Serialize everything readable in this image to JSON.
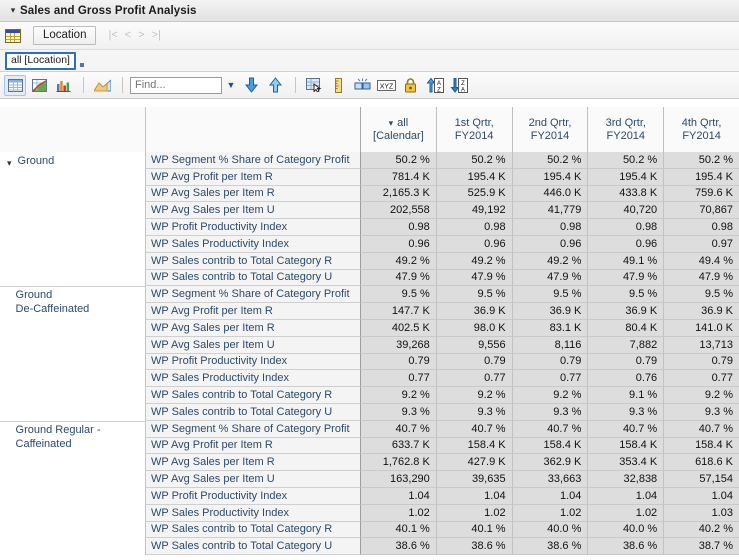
{
  "window": {
    "title": "Sales and Gross Profit Analysis",
    "collapse_icon": "chevron-down-icon"
  },
  "filter_bar": {
    "grid_icon": "grid-icon",
    "dimension_button": "Location",
    "nav_first": "|<",
    "nav_prev": "<",
    "nav_next": ">",
    "nav_last": ">|"
  },
  "token_bar": {
    "token": "all [Location]",
    "marker": "resize-handle-icon"
  },
  "toolbar": {
    "buttons": [
      {
        "name": "table-view-icon",
        "selected": true
      },
      {
        "name": "chart-table-view-icon",
        "selected": false
      },
      {
        "name": "bar-chart-icon",
        "selected": false
      },
      {
        "name": "area-chart-icon",
        "selected": false
      }
    ],
    "find_placeholder": "Find...",
    "find_value": "",
    "find_dropdown_icon": "chevron-down-icon",
    "find_next_icon": "arrow-down-icon",
    "find_prev_icon": "arrow-up-icon",
    "right_buttons": [
      {
        "name": "select-cells-icon"
      },
      {
        "name": "ruler-icon"
      },
      {
        "name": "break-link-icon"
      },
      {
        "name": "xyz-format-icon"
      },
      {
        "name": "lock-icon"
      },
      {
        "name": "sort-ascending-icon"
      },
      {
        "name": "sort-descending-icon"
      }
    ]
  },
  "pivot": {
    "corner_row_header": "",
    "corner_measure_header": "",
    "column_headers": [
      {
        "line1": "all",
        "line2": "[Calendar]",
        "has_caret": true
      },
      {
        "line1": "1st Qrtr,",
        "line2": "FY2014",
        "has_caret": false
      },
      {
        "line1": "2nd Qrtr,",
        "line2": "FY2014",
        "has_caret": false
      },
      {
        "line1": "3rd Qrtr,",
        "line2": "FY2014",
        "has_caret": false
      },
      {
        "line1": "4th Qrtr,",
        "line2": "FY2014",
        "has_caret": false
      }
    ],
    "measures": [
      "WP Segment % Share of Category Profit",
      "WP Avg Profit per Item R",
      "WP Avg Sales per Item R",
      "WP Avg Sales per Item U",
      "WP Profit Productivity Index",
      "WP Sales Productivity Index",
      "WP Sales contrib to Total Category R",
      "WP Sales contrib to Total Category U"
    ],
    "groups": [
      {
        "label": "Ground",
        "label_line2": "",
        "has_caret": true,
        "rows": [
          [
            "50.2 %",
            "50.2 %",
            "50.2 %",
            "50.2 %",
            "50.2 %"
          ],
          [
            "781.4 K",
            "195.4 K",
            "195.4 K",
            "195.4 K",
            "195.4 K"
          ],
          [
            "2,165.3 K",
            "525.9 K",
            "446.0 K",
            "433.8 K",
            "759.6 K"
          ],
          [
            "202,558",
            "49,192",
            "41,779",
            "40,720",
            "70,867"
          ],
          [
            "0.98",
            "0.98",
            "0.98",
            "0.98",
            "0.98"
          ],
          [
            "0.96",
            "0.96",
            "0.96",
            "0.96",
            "0.97"
          ],
          [
            "49.2 %",
            "49.2 %",
            "49.2 %",
            "49.1 %",
            "49.4 %"
          ],
          [
            "47.9 %",
            "47.9 %",
            "47.9 %",
            "47.9 %",
            "47.9 %"
          ]
        ]
      },
      {
        "label": "Ground",
        "label_line2": "De-Caffeinated",
        "has_caret": false,
        "rows": [
          [
            "9.5 %",
            "9.5 %",
            "9.5 %",
            "9.5 %",
            "9.5 %"
          ],
          [
            "147.7 K",
            "36.9 K",
            "36.9 K",
            "36.9 K",
            "36.9 K"
          ],
          [
            "402.5 K",
            "98.0 K",
            "83.1 K",
            "80.4 K",
            "141.0 K"
          ],
          [
            "39,268",
            "9,556",
            "8,116",
            "7,882",
            "13,713"
          ],
          [
            "0.79",
            "0.79",
            "0.79",
            "0.79",
            "0.79"
          ],
          [
            "0.77",
            "0.77",
            "0.77",
            "0.76",
            "0.77"
          ],
          [
            "9.2 %",
            "9.2 %",
            "9.2 %",
            "9.1 %",
            "9.2 %"
          ],
          [
            "9.3 %",
            "9.3 %",
            "9.3 %",
            "9.3 %",
            "9.3 %"
          ]
        ]
      },
      {
        "label": "Ground Regular -",
        "label_line2": "Caffeinated",
        "has_caret": false,
        "rows": [
          [
            "40.7 %",
            "40.7 %",
            "40.7 %",
            "40.7 %",
            "40.7 %"
          ],
          [
            "633.7 K",
            "158.4 K",
            "158.4 K",
            "158.4 K",
            "158.4 K"
          ],
          [
            "1,762.8 K",
            "427.9 K",
            "362.9 K",
            "353.4 K",
            "618.6 K"
          ],
          [
            "163,290",
            "39,635",
            "33,663",
            "32,838",
            "57,154"
          ],
          [
            "1.04",
            "1.04",
            "1.04",
            "1.04",
            "1.04"
          ],
          [
            "1.02",
            "1.02",
            "1.02",
            "1.02",
            "1.03"
          ],
          [
            "40.1 %",
            "40.1 %",
            "40.0 %",
            "40.0 %",
            "40.2 %"
          ],
          [
            "38.6 %",
            "38.6 %",
            "38.6 %",
            "38.6 %",
            "38.7 %"
          ]
        ]
      }
    ]
  },
  "colors": {
    "header_text": "#2b4a6b",
    "value_bg": "#dddddd",
    "measure_bg": "#f4f4f4",
    "accent_blue": "#2f6fb5"
  }
}
